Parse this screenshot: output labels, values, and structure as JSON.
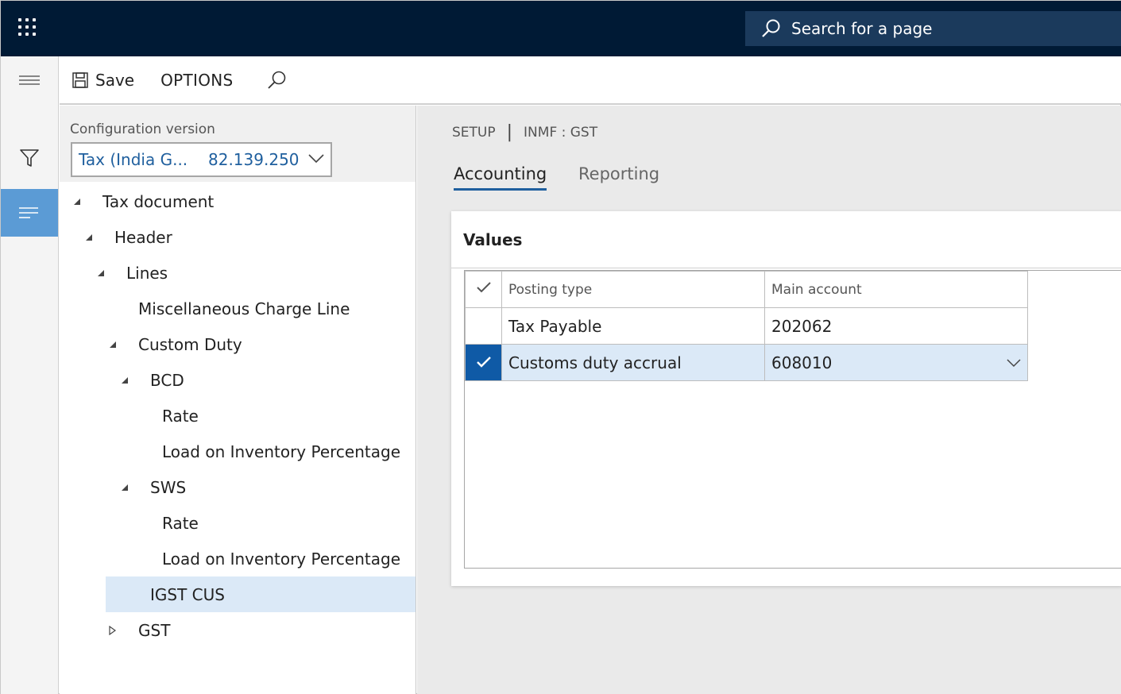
{
  "topbar": {
    "search_placeholder": "Search for a page"
  },
  "actionbar": {
    "save_label": "Save",
    "options_label": "OPTIONS"
  },
  "config": {
    "label": "Configuration version",
    "name": "Tax (India G...",
    "version": "82.139.250"
  },
  "tree": {
    "nodes": [
      {
        "label": "Tax document",
        "state": "expanded"
      },
      {
        "label": "Header",
        "state": "expanded"
      },
      {
        "label": "Lines",
        "state": "expanded"
      },
      {
        "label": "Miscellaneous Charge Line",
        "state": "leaf"
      },
      {
        "label": "Custom Duty",
        "state": "expanded"
      },
      {
        "label": "BCD",
        "state": "expanded"
      },
      {
        "label": "Rate",
        "state": "leaf"
      },
      {
        "label": "Load on Inventory Percentage",
        "state": "leaf"
      },
      {
        "label": "SWS",
        "state": "expanded"
      },
      {
        "label": "Rate",
        "state": "leaf"
      },
      {
        "label": "Load on Inventory Percentage",
        "state": "leaf"
      },
      {
        "label": "IGST CUS",
        "state": "leaf",
        "selected": true
      },
      {
        "label": "GST",
        "state": "collapsed"
      }
    ]
  },
  "breadcrumb": {
    "section": "SETUP",
    "item": "INMF : GST"
  },
  "tabs": [
    {
      "label": "Accounting",
      "active": true
    },
    {
      "label": "Reporting",
      "active": false
    }
  ],
  "values_card": {
    "title": "Values",
    "columns": [
      "Posting type",
      "Main account"
    ],
    "rows": [
      {
        "posting_type": "Tax Payable",
        "main_account": "202062",
        "selected": false
      },
      {
        "posting_type": "Customs duty accrual",
        "main_account": "608010",
        "selected": true
      }
    ]
  },
  "colors": {
    "topbar": "#001a35",
    "search_box": "#1b3a5c",
    "accent": "#1f5f9e",
    "rail_active": "#5b9bd5",
    "selected_row": "#dbe9f7",
    "check_cell": "#0f5aa6"
  }
}
